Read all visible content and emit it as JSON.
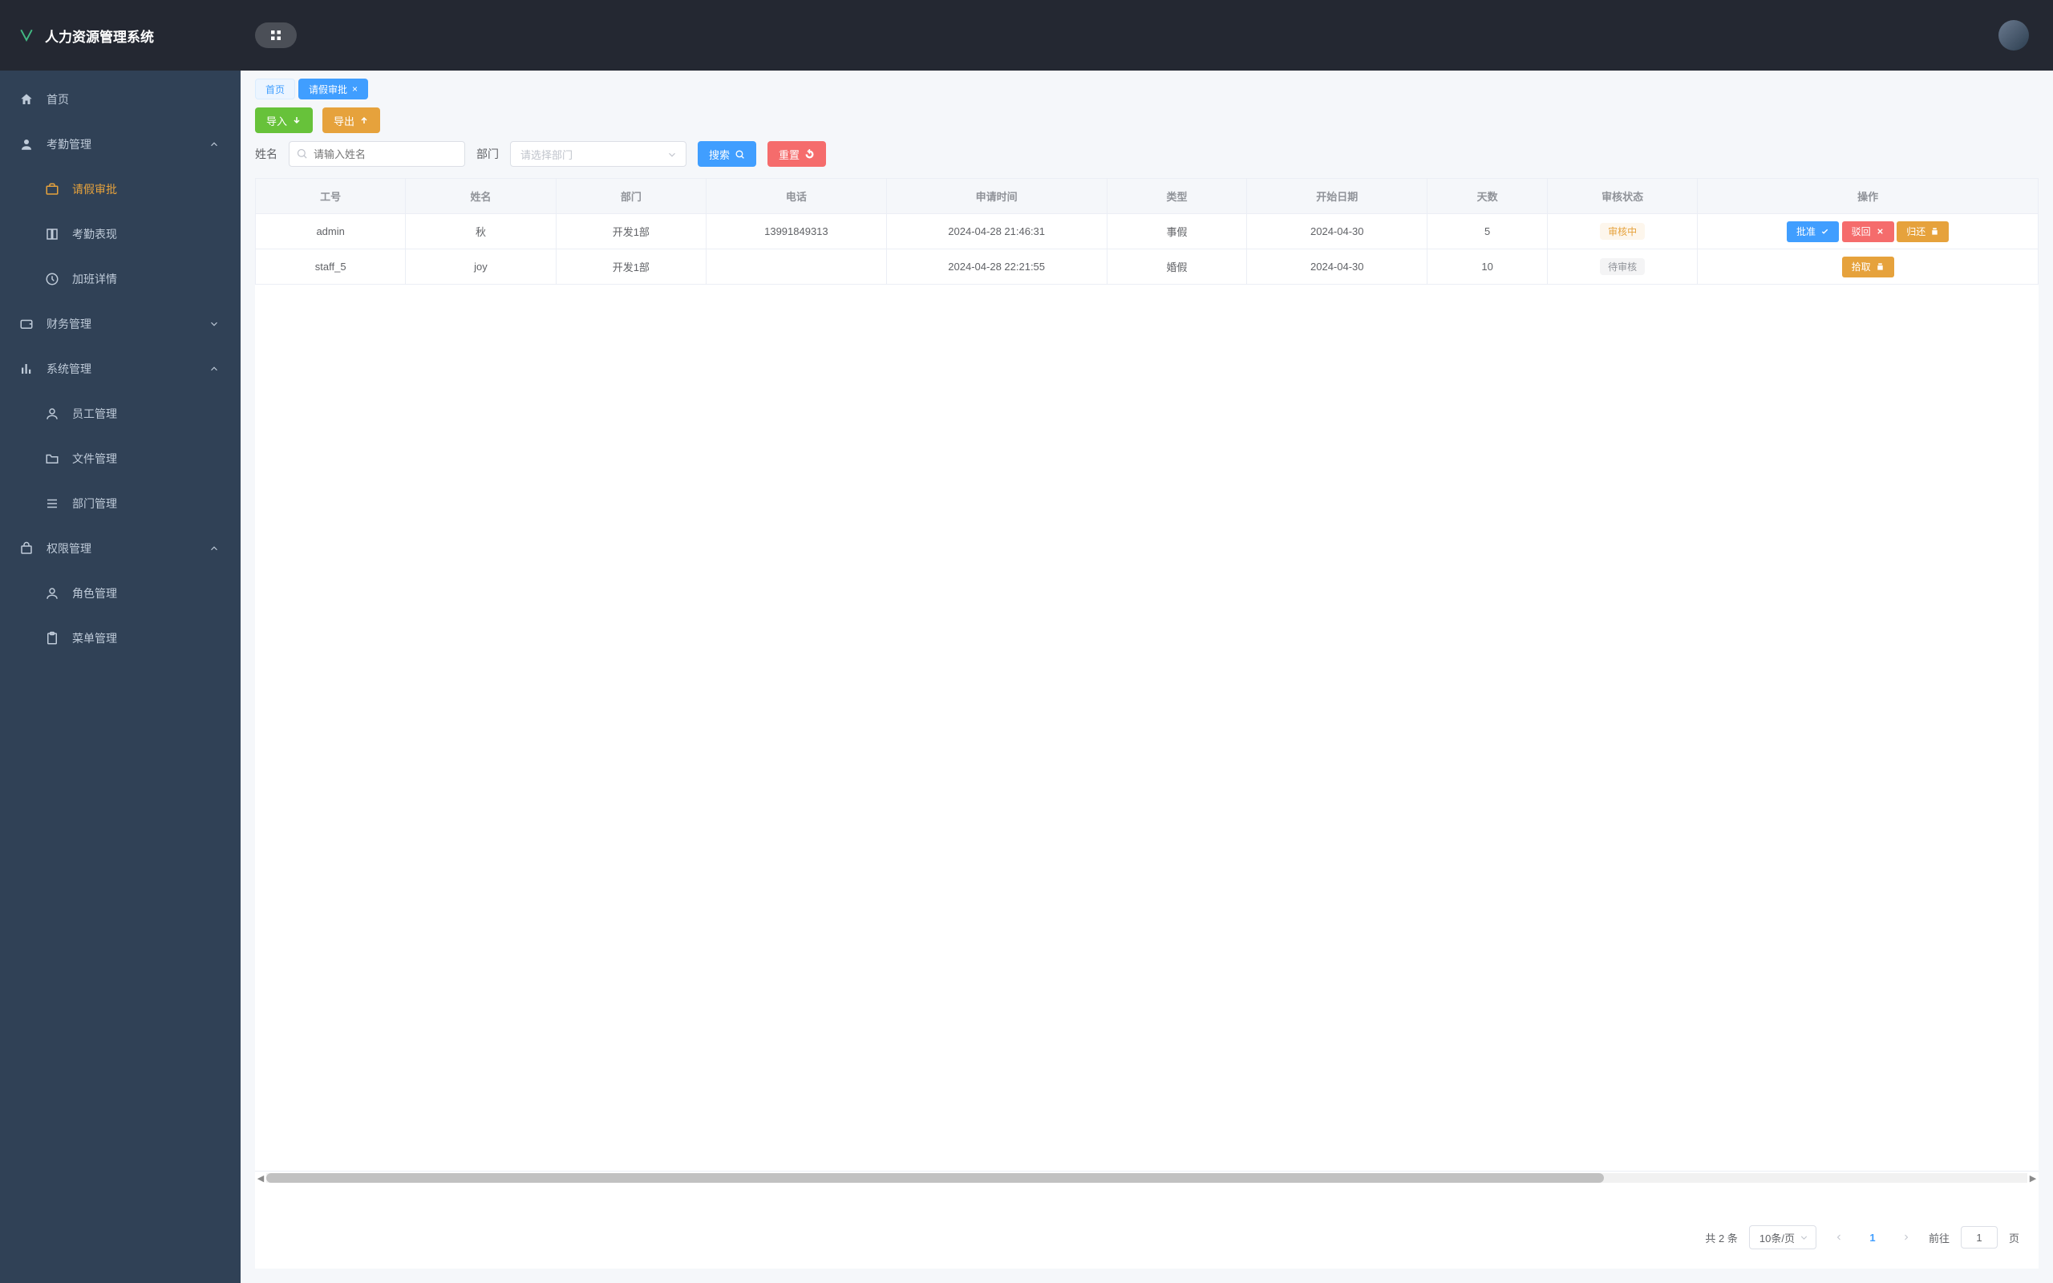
{
  "app": {
    "title": "人力资源管理系统"
  },
  "sidebar": {
    "home": "首页",
    "attendance": {
      "label": "考勤管理",
      "leave": "请假审批",
      "record": "考勤表现",
      "overtime": "加班详情"
    },
    "finance": {
      "label": "财务管理"
    },
    "system": {
      "label": "系统管理",
      "staff": "员工管理",
      "file": "文件管理",
      "dept": "部门管理"
    },
    "perm": {
      "label": "权限管理",
      "role": "角色管理",
      "menu": "菜单管理"
    }
  },
  "tabs": {
    "home": "首页",
    "active": "请假审批"
  },
  "toolbar": {
    "import": "导入",
    "export": "导出"
  },
  "filters": {
    "name_label": "姓名",
    "name_placeholder": "请输入姓名",
    "dept_label": "部门",
    "dept_placeholder": "请选择部门",
    "search": "搜索",
    "reset": "重置"
  },
  "table": {
    "headers": {
      "id": "工号",
      "name": "姓名",
      "dept": "部门",
      "phone": "电话",
      "apply_time": "申请时间",
      "type": "类型",
      "start": "开始日期",
      "days": "天数",
      "status": "审核状态",
      "op": "操作"
    },
    "rows": [
      {
        "id": "admin",
        "name": "秋",
        "dept": "开发1部",
        "phone": "13991849313",
        "apply_time": "2024-04-28 21:46:31",
        "type": "事假",
        "start": "2024-04-30",
        "days": "5",
        "status": "审核中",
        "status_kind": "warn",
        "ops": [
          "approve",
          "reject",
          "return"
        ]
      },
      {
        "id": "staff_5",
        "name": "joy",
        "dept": "开发1部",
        "phone": "",
        "apply_time": "2024-04-28 22:21:55",
        "type": "婚假",
        "start": "2024-04-30",
        "days": "10",
        "status": "待审核",
        "status_kind": "info",
        "ops": [
          "claim"
        ]
      }
    ],
    "actions": {
      "approve": "批准",
      "reject": "驳回",
      "return": "归还",
      "claim": "拾取"
    }
  },
  "pager": {
    "total_prefix": "共",
    "total": "2",
    "total_suffix": "条",
    "page_size": "10条/页",
    "current": "1",
    "goto_prefix": "前往",
    "goto_value": "1",
    "goto_suffix": "页"
  }
}
